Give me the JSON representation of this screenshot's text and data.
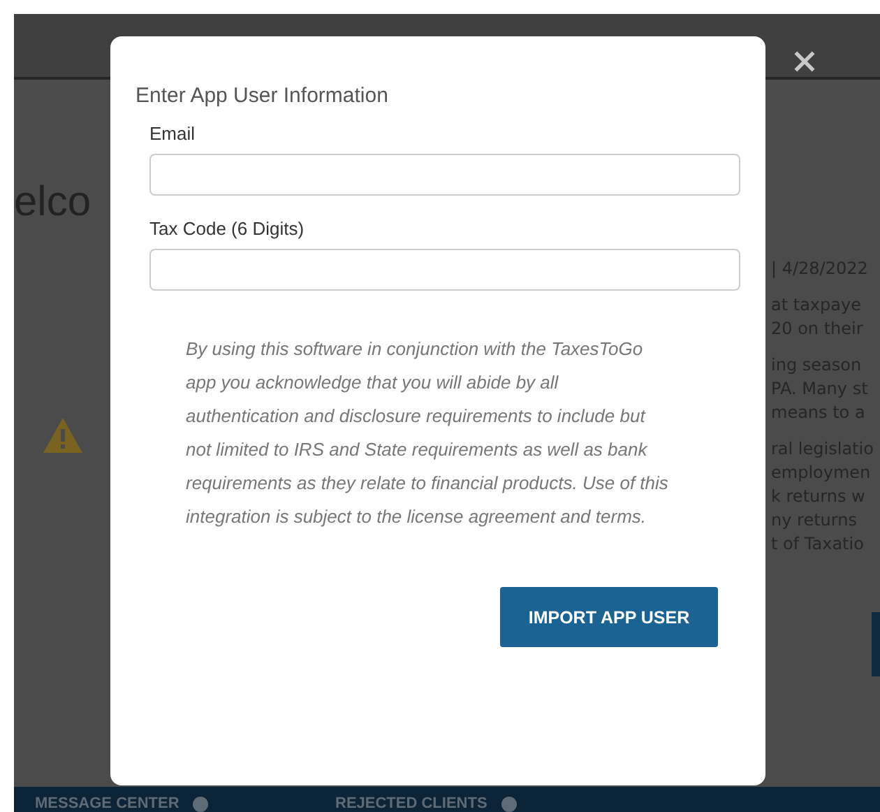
{
  "background": {
    "heading": "elco",
    "date": "| 4/28/2022",
    "paragraphs": [
      [
        "at taxpaye",
        "20 on their"
      ],
      [
        "ing season",
        "PA. Many st",
        "means to a"
      ],
      [
        "ral legislatio",
        "employmen",
        "k returns w",
        "ny returns",
        "t of Taxatio"
      ]
    ],
    "tabs": [
      "MESSAGE CENTER",
      "REJECTED CLIENTS"
    ]
  },
  "modal": {
    "title": "Enter App User Information",
    "fields": [
      {
        "label": "Email"
      },
      {
        "label": "Tax Code (6 Digits)"
      }
    ],
    "notice": "By using this software in conjunction with the TaxesToGo app you acknowledge that you will abide by all authentication and disclosure requirements to include but not limited to IRS and State requirements as well as bank requirements as they relate to financial products. Use of this integration is subject to the license agreement and terms.",
    "button": "IMPORT APP USER"
  }
}
